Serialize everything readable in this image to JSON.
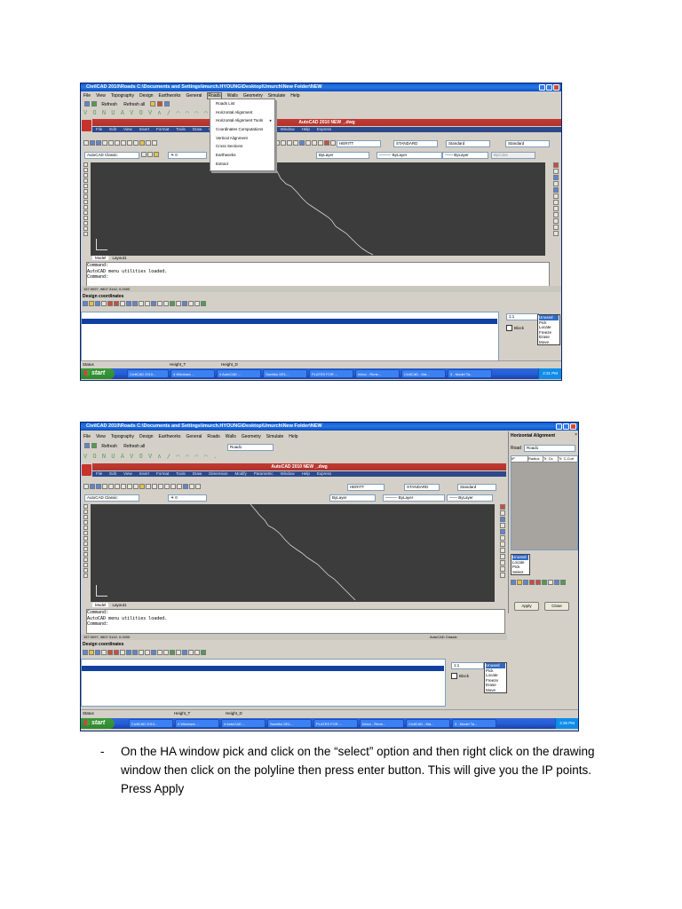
{
  "shot1": {
    "title": "CivilCAD 2010\\Roads  C:\\Documents and Settings\\imurch.HYOUNG\\Desktop\\Umurch\\New Folder\\NEW",
    "menu": [
      "File",
      "View",
      "Topography",
      "Design",
      "Earthworks",
      "General",
      "Roads",
      "Walls",
      "Geometry",
      "Simulate",
      "Help"
    ],
    "toolbar": {
      "refresh": "Refresh",
      "refresh_all": "Refresh all"
    },
    "roads_menu": [
      "Roads List",
      "Horizontal Alignment",
      "Horizontal Alignment Tools",
      "Coordinates Computations",
      "Vertical Alignment",
      "Cross Sections",
      "Earthworks",
      "Extract"
    ],
    "acad_title": "AutoCAD 2010    NEW _.dwg",
    "acad_menu": [
      "File",
      "Edit",
      "View",
      "Insert",
      "Format",
      "Tools",
      "Draw",
      "Dimension",
      "Modify",
      "Parametric",
      "Window",
      "Help",
      "Express"
    ],
    "workspace": "AutoCAD Classic",
    "style_combos": [
      "HERITT",
      "STANDARD",
      "Standard",
      "Standard"
    ],
    "layer_combos": [
      "ByLayer",
      "ByLayer",
      "ByLayer",
      "ByColor"
    ],
    "tabs": [
      "Model",
      "Layout1"
    ],
    "command_lines": [
      "Command:",
      "AutoCAD menu utilities loaded.",
      "",
      "Command:"
    ],
    "coords": "157.9097, 9807.3142, 0.0000",
    "status_items": [
      "SNAP",
      "GRID",
      "ORTHO",
      "POLAR",
      "OSNAP",
      "OTRACK",
      "DUCS",
      "DYN",
      "LWT",
      "QP"
    ],
    "design_coords": "Design coordinates",
    "scale": "1:1",
    "block_label": "Block",
    "options": [
      "Unused",
      "Pick",
      "Locate",
      "Freeze",
      "Erase",
      "Move"
    ],
    "status_fields": [
      "Status",
      "Height_T",
      "Height_D"
    ],
    "start": "start",
    "taskbar_items": [
      "CivilCAD 2010...",
      "4 Windows ...",
      "4 AutoCAD ...",
      "Sachiko DEL...",
      "PLATES FOR ...",
      "Inbox - Rene...",
      "CivilCAD - Ma...",
      "3 - Model Ta..."
    ],
    "clock": "2:31 PM"
  },
  "shot2": {
    "title": "CivilCAD 2010\\Roads  C:\\Documents and Settings\\imurch.HYOUNG\\Desktop\\Umurch\\New Folder\\NEW",
    "road_combo": "Road1",
    "acad_title": "AutoCAD 2010    NEW _.dwg",
    "ha_title": "Horizontal Alignment",
    "road_label": "Road",
    "road_value": "Road1",
    "ha_columns": [
      "IP",
      "Radius",
      "Tr. Cs",
      "Tr. C.Curl"
    ],
    "ha_options": [
      "Unused",
      "Locate",
      "Pick",
      "Select"
    ],
    "apply": "Apply",
    "close": "Close",
    "options": [
      "Unused",
      "Pick",
      "Locate",
      "Freeze",
      "Erase",
      "Move"
    ],
    "acad_classic_task": "AutoCAD Classic",
    "clock": "2:35 PM"
  },
  "instruction": {
    "bullet": "-",
    "text": "On the HA window pick and click on the “select” option and then right click on the drawing window then click on the polyline then press enter button. This will give you the IP points. Press Apply"
  }
}
